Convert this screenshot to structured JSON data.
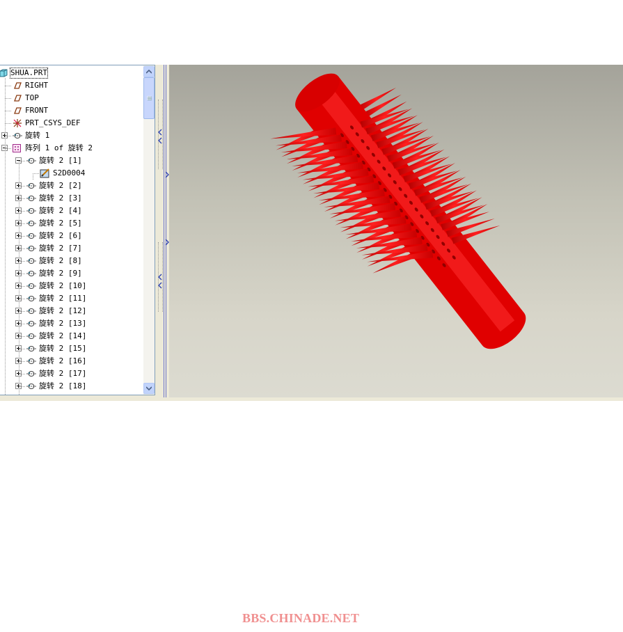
{
  "model_tree": {
    "items": [
      {
        "label": "SHUA.PRT",
        "icon": "part-icon",
        "expander": "",
        "selected": true
      },
      {
        "label": "RIGHT",
        "icon": "datum-plane-icon",
        "expander": ""
      },
      {
        "label": "TOP",
        "icon": "datum-plane-icon",
        "expander": ""
      },
      {
        "label": "FRONT",
        "icon": "datum-plane-icon",
        "expander": ""
      },
      {
        "label": "PRT_CSYS_DEF",
        "icon": "csys-icon",
        "expander": ""
      },
      {
        "label": "旋转 1",
        "icon": "revolve-icon",
        "expander": "plus"
      },
      {
        "label": "阵列 1 of 旋转 2",
        "icon": "pattern-icon",
        "expander": "minus"
      },
      {
        "label": "旋转 2 [1]",
        "icon": "revolve-icon",
        "expander": "minus"
      },
      {
        "label": "S2D0004",
        "icon": "sketch-icon",
        "expander": ""
      },
      {
        "label": "旋转 2 [2]",
        "icon": "revolve-icon",
        "expander": "plus"
      },
      {
        "label": "旋转 2 [3]",
        "icon": "revolve-icon",
        "expander": "plus"
      },
      {
        "label": "旋转 2 [4]",
        "icon": "revolve-icon",
        "expander": "plus"
      },
      {
        "label": "旋转 2 [5]",
        "icon": "revolve-icon",
        "expander": "plus"
      },
      {
        "label": "旋转 2 [6]",
        "icon": "revolve-icon",
        "expander": "plus"
      },
      {
        "label": "旋转 2 [7]",
        "icon": "revolve-icon",
        "expander": "plus"
      },
      {
        "label": "旋转 2 [8]",
        "icon": "revolve-icon",
        "expander": "plus"
      },
      {
        "label": "旋转 2 [9]",
        "icon": "revolve-icon",
        "expander": "plus"
      },
      {
        "label": "旋转 2 [10]",
        "icon": "revolve-icon",
        "expander": "plus"
      },
      {
        "label": "旋转 2 [11]",
        "icon": "revolve-icon",
        "expander": "plus"
      },
      {
        "label": "旋转 2 [12]",
        "icon": "revolve-icon",
        "expander": "plus"
      },
      {
        "label": "旋转 2 [13]",
        "icon": "revolve-icon",
        "expander": "plus"
      },
      {
        "label": "旋转 2 [14]",
        "icon": "revolve-icon",
        "expander": "plus"
      },
      {
        "label": "旋转 2 [15]",
        "icon": "revolve-icon",
        "expander": "plus"
      },
      {
        "label": "旋转 2 [16]",
        "icon": "revolve-icon",
        "expander": "plus"
      },
      {
        "label": "旋转 2 [17]",
        "icon": "revolve-icon",
        "expander": "plus"
      },
      {
        "label": "旋转 2 [18]",
        "icon": "revolve-icon",
        "expander": "plus"
      }
    ]
  },
  "viewport": {
    "model_color": "#e60000",
    "background_top": "#a4a39a",
    "background_bottom": "#dcdbd1"
  },
  "watermark": {
    "text": "BBS.CHINADE.NET",
    "color": "#f09090"
  }
}
